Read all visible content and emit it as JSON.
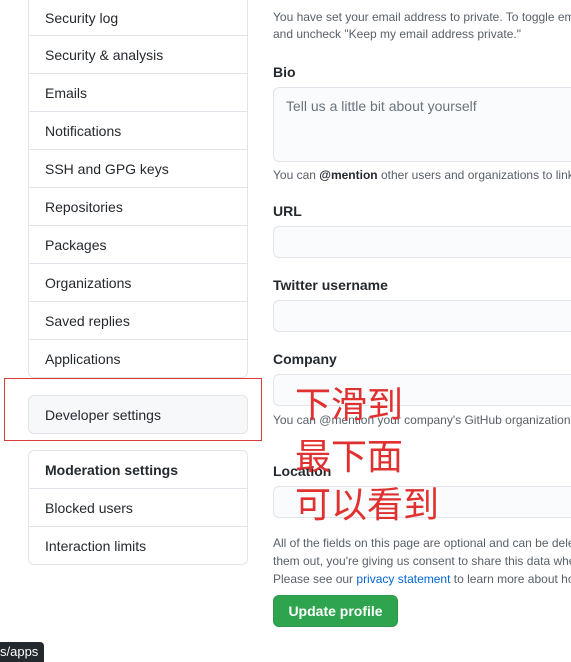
{
  "sidebar": {
    "items": [
      {
        "label": "Security log"
      },
      {
        "label": "Security & analysis"
      },
      {
        "label": "Emails"
      },
      {
        "label": "Notifications"
      },
      {
        "label": "SSH and GPG keys"
      },
      {
        "label": "Repositories"
      },
      {
        "label": "Packages"
      },
      {
        "label": "Organizations"
      },
      {
        "label": "Saved replies"
      },
      {
        "label": "Applications"
      }
    ],
    "developer_settings": "Developer settings",
    "moderation": {
      "heading": "Moderation settings",
      "items": [
        {
          "label": "Blocked users"
        },
        {
          "label": "Interaction limits"
        }
      ]
    }
  },
  "form": {
    "email_note_1": "You have set your email address to private. To toggle em",
    "email_note_2": "and uncheck \"Keep my email address private.\"",
    "bio_label": "Bio",
    "bio_placeholder": "Tell us a little bit about yourself",
    "bio_hint_pre": "You can ",
    "bio_hint_mention": "@mention",
    "bio_hint_post": " other users and organizations to link",
    "url_label": "URL",
    "twitter_label": "Twitter username",
    "company_label": "Company",
    "company_hint": "You can @mention your company's GitHub organization",
    "location_label": "Location",
    "footer_1": "All of the fields on this page are optional and can be dele",
    "footer_2": "them out, you're giving us consent to share this data whe",
    "footer_3_pre": "Please see our ",
    "footer_3_link": "privacy statement",
    "footer_3_post": " to learn more about ho",
    "update_button": "Update profile"
  },
  "annotation": {
    "line1": "下滑到",
    "line2": "最下面",
    "line3": "可以看到",
    "color": "#e03030"
  },
  "statusbar": {
    "text": "s/apps"
  }
}
